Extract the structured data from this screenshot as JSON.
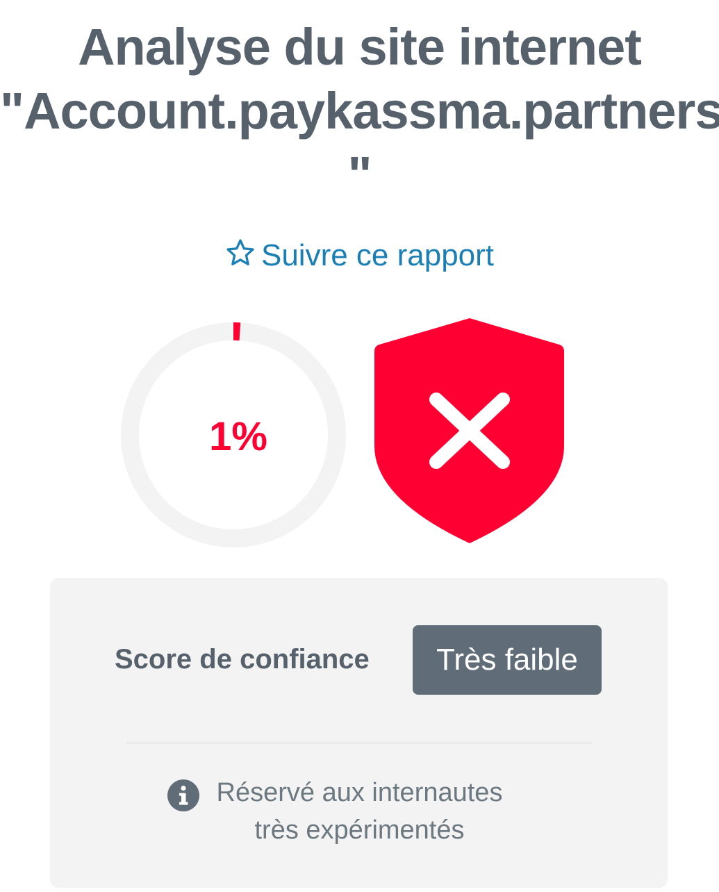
{
  "header": {
    "title_line1": "Analyse du site internet",
    "title_line2": "\"Account.paykassma.partners",
    "title_line3": "\""
  },
  "follow": {
    "label": "Suivre ce rapport",
    "icon": "star-outline-icon",
    "color": "#1a7fb5"
  },
  "trust_gauge": {
    "value_label": "1%",
    "percent": 1,
    "track_color": "#f3f3f3",
    "fill_color": "#ff0033"
  },
  "shield": {
    "icon": "shield-x-icon",
    "color": "#ff0033"
  },
  "score_card": {
    "label": "Score de confiance",
    "badge": "Très faible",
    "badge_color": "#606c78",
    "info_icon": "info-circle-icon",
    "note": "Réservé aux internautes très expérimentés"
  }
}
